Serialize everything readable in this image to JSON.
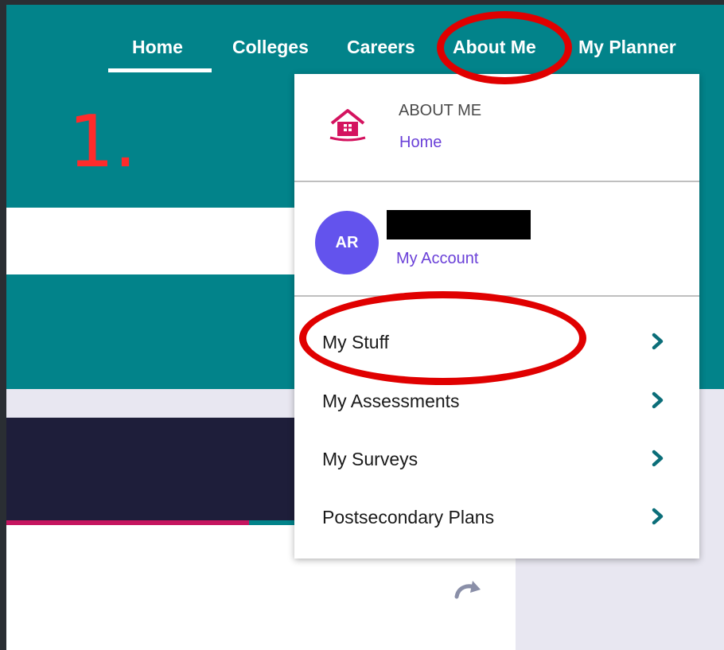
{
  "nav": {
    "items": [
      {
        "label": "Home"
      },
      {
        "label": "Colleges"
      },
      {
        "label": "Careers"
      },
      {
        "label": "About Me"
      },
      {
        "label": "My Planner"
      }
    ],
    "active": "Home"
  },
  "annotation": {
    "step_number": "1."
  },
  "dropdown": {
    "section_title": "ABOUT ME",
    "home_link": "Home",
    "user": {
      "initials": "AR",
      "account_link": "My Account"
    },
    "menu_items": [
      {
        "label": "My Stuff",
        "icon": "chevron-right-icon"
      },
      {
        "label": "My Assessments",
        "icon": "chevron-right-icon"
      },
      {
        "label": "My Surveys",
        "icon": "chevron-right-icon"
      },
      {
        "label": "Postsecondary Plans",
        "icon": "chevron-right-icon"
      }
    ]
  },
  "colors": {
    "header_teal": "#02838a",
    "link_purple": "#6a40d8",
    "avatar_purple": "#6353ed",
    "house_pink": "#d4135f",
    "chevron_teal": "#0b6e79",
    "annotation_red": "#e00000"
  }
}
